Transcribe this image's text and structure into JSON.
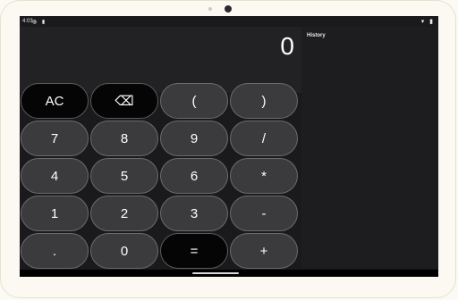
{
  "status_bar": {
    "time": "4:03",
    "icons_left": "◍ ▮",
    "icons_right": "▾ ▮"
  },
  "display": {
    "value": "0"
  },
  "history": {
    "title": "History"
  },
  "keys": {
    "ac": "AC",
    "backspace": "⌫",
    "open_paren": "(",
    "close_paren": ")",
    "seven": "7",
    "eight": "8",
    "nine": "9",
    "divide": "/",
    "four": "4",
    "five": "5",
    "six": "6",
    "multiply": "*",
    "one": "1",
    "two": "2",
    "three": "3",
    "minus": "-",
    "decimal": ".",
    "zero": "0",
    "equals": "=",
    "plus": "+"
  }
}
